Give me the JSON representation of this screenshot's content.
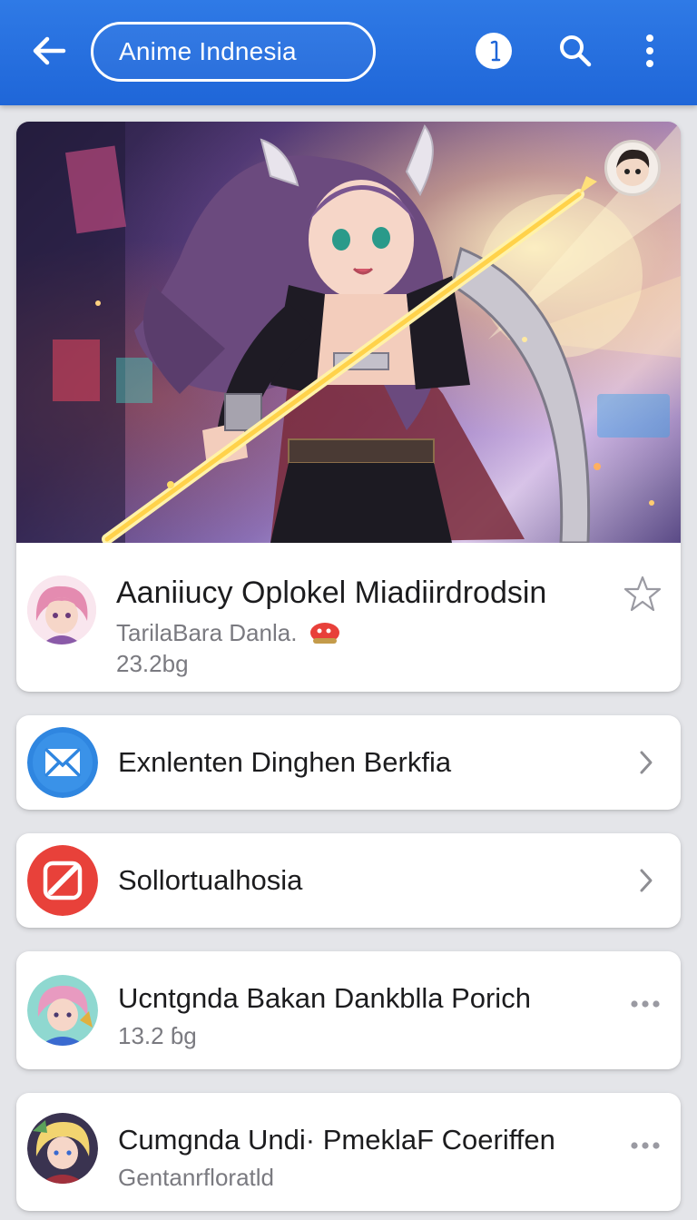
{
  "header": {
    "title": "Anime Indnesia",
    "back_icon": "back-arrow-icon",
    "info_icon": "info-icon",
    "search_icon": "search-icon",
    "more_icon": "more-vertical-icon",
    "background": "#2f7ae6"
  },
  "featured": {
    "title": "Aaniiucy Oplokel Miadiirdrodsin",
    "subtitle": "TarilaBara Danla.",
    "size": "23.2bg",
    "favorite_icon": "star-outline-icon"
  },
  "list": [
    {
      "label": "Exnlenten Dinghen Berkfia",
      "icon": "mail-icon",
      "icon_color": "#2f86e0",
      "trailing": "chevron-right-icon"
    },
    {
      "label": "Sollortualhosia",
      "icon": "slash-icon",
      "icon_color": "#e8413a",
      "trailing": "chevron-right-icon"
    },
    {
      "label": "Ucntgnda Bakan Dankblla Porich",
      "sub": "13.2 ɓg",
      "icon": "avatar-icon",
      "trailing": "more-horizontal-icon"
    },
    {
      "label": "Cumgnda Undi· PmeklaF Coeriffen",
      "sub": "Gentanrfloratld",
      "icon": "avatar-icon",
      "trailing": "more-horizontal-icon"
    }
  ]
}
